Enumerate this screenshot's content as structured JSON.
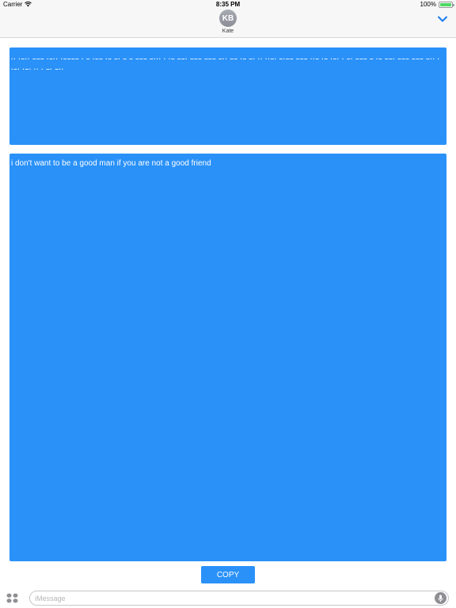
{
  "status_bar": {
    "carrier": "Carrier",
    "time": "8:35 PM",
    "battery": "100%",
    "battery_level": 1.0,
    "battery_color": "#4cd964"
  },
  "header": {
    "avatar_initials": "KB",
    "contact_name": "Kate",
    "collapse_icon": "chevron-down-icon",
    "accent_color": "#1a7cf0"
  },
  "morse_panel": {
    "text": "·· ·–·· ––– ·–·· ·–––– · –  ·–– ·– –· –  – –––  –··· ·  ·–  ––· ––– ––– –··  –– ·– –·  ·· ··–·  –·–– ––– ··–  ·– ·–· ·  –· ––– –  ·–  ––· ––– ––– –··  ··–· ·–· ·· · –· –··"
  },
  "text_panel": {
    "text": "i don't want to be a good man if you are not a good friend"
  },
  "panel_color": "#2a91f8",
  "copy_button": {
    "label": "COPY"
  },
  "input_bar": {
    "placeholder": "iMessage",
    "apps_icon": "app-grid-icon",
    "mic_icon": "microphone-icon"
  }
}
